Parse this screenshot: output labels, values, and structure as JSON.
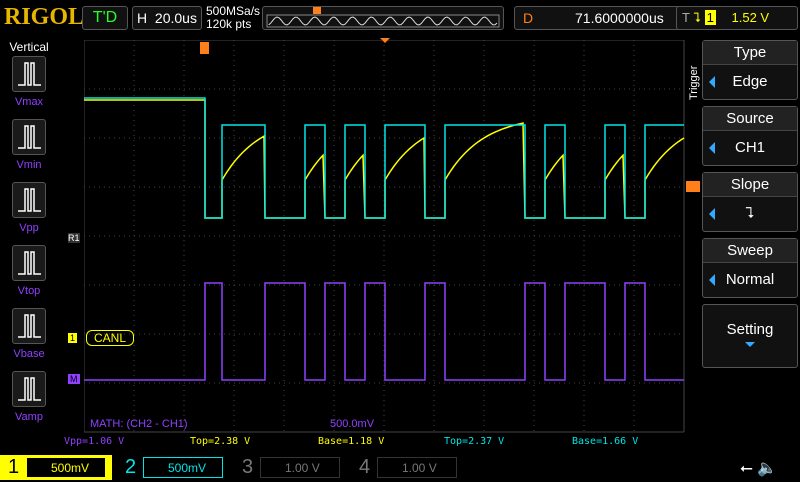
{
  "header": {
    "logo": "RIGOL",
    "run_status": "T'D",
    "timebase_label": "H",
    "timebase": "20.0us",
    "sample_rate": "500MSa/s",
    "memory_depth": "120k pts",
    "delay_label": "D",
    "delay": "71.6000000us",
    "trigger_label": "T",
    "trigger_source": "1",
    "trigger_level": "1.52 V"
  },
  "left_menu": {
    "title": "Vertical",
    "items": [
      {
        "label": "Vmax"
      },
      {
        "label": "Vmin"
      },
      {
        "label": "Vpp"
      },
      {
        "label": "Vtop"
      },
      {
        "label": "Vbase"
      },
      {
        "label": "Vamp"
      }
    ]
  },
  "right_menu": {
    "title": "Trigger",
    "items": [
      {
        "label": "Type",
        "value": "Edge"
      },
      {
        "label": "Source",
        "value": "CH1"
      },
      {
        "label": "Slope",
        "value": "falling-edge-icon"
      },
      {
        "label": "Sweep",
        "value": "Normal"
      },
      {
        "label": "Setting",
        "value": ""
      }
    ]
  },
  "screen": {
    "math_label": "MATH: (CH2 - CH1)",
    "math_scale": "500.0mV",
    "ch1_label": "CANL",
    "ref_marker": "R1",
    "math_marker": "M",
    "ch1_marker": "1"
  },
  "measurements": [
    {
      "text": "Vpp=1.06 V",
      "color": "#9040ff"
    },
    {
      "text": "Top=2.38 V",
      "color": "#ffff00"
    },
    {
      "text": "Base=1.18 V",
      "color": "#ffff00"
    },
    {
      "text": "Top=2.37 V",
      "color": "#00e5e5"
    },
    {
      "text": "Base=1.66 V",
      "color": "#00e5e5"
    }
  ],
  "channels": [
    {
      "num": "1",
      "scale": "500mV",
      "color": "#ffff00",
      "active": true
    },
    {
      "num": "2",
      "scale": "500mV",
      "color": "#00e5e5",
      "active": true
    },
    {
      "num": "3",
      "scale": "1.00 V",
      "color": "#777",
      "active": false
    },
    {
      "num": "4",
      "scale": "1.00 V",
      "color": "#777",
      "active": false
    }
  ],
  "colors": {
    "ch1": "#ffff00",
    "ch2": "#00e5e5",
    "math": "#9040ff",
    "trigger": "#ff7f1a"
  }
}
